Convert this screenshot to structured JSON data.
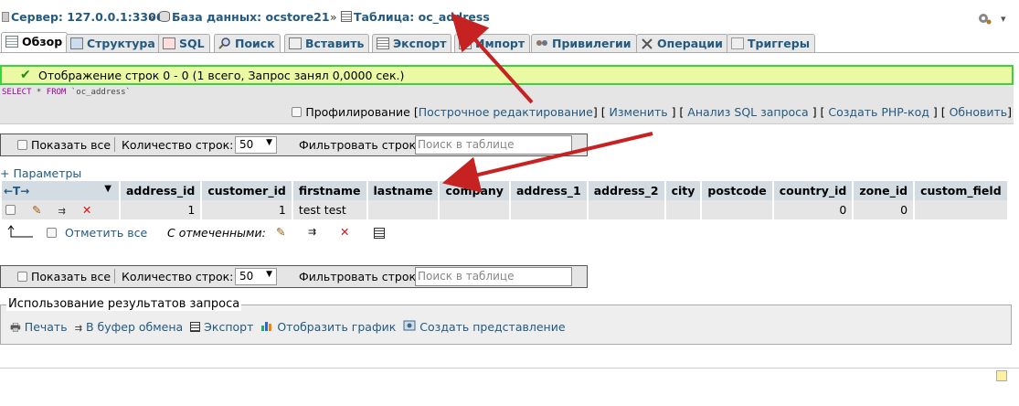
{
  "breadcrumb": {
    "server": "Сервер: 127.0.0.1:3306",
    "database": "База данных: ocstore21",
    "table": "Таблица: oc_address",
    "separator": "»"
  },
  "tabs": [
    {
      "label": "Обзор",
      "icon": "browse-icon",
      "active": true
    },
    {
      "label": "Структура",
      "icon": "structure-icon"
    },
    {
      "label": "SQL",
      "icon": "sql-icon"
    },
    {
      "label": "Поиск",
      "icon": "search-icon"
    },
    {
      "label": "Вставить",
      "icon": "insert-icon"
    },
    {
      "label": "Экспорт",
      "icon": "export-icon"
    },
    {
      "label": "Импорт",
      "icon": "import-icon"
    },
    {
      "label": "Привилегии",
      "icon": "privileges-icon"
    },
    {
      "label": "Операции",
      "icon": "operations-icon"
    },
    {
      "label": "Триггеры",
      "icon": "triggers-icon"
    }
  ],
  "success": {
    "message": "Отображение строк 0 - 0 (1 всего, Запрос занял 0,0000 сек.)"
  },
  "sql": {
    "select": "SELECT",
    "star": " * ",
    "from": "FROM",
    "table": " `oc_address`"
  },
  "sql_links": {
    "profiling": "Профилирование",
    "inline_edit": "Построчное редактирование",
    "edit": "Изменить",
    "explain": "Анализ SQL запроса",
    "php": "Создать PHP-код",
    "refresh": "Обновить"
  },
  "nav": {
    "show_all": "Показать все",
    "rows_label": "Количество строк:",
    "rows_value": "50",
    "filter_label": "Фильтровать строки:",
    "filter_placeholder": "Поиск в таблице"
  },
  "params_label": "+ Параметры",
  "table": {
    "columns": [
      "address_id",
      "customer_id",
      "firstname",
      "lastname",
      "company",
      "address_1",
      "address_2",
      "city",
      "postcode",
      "country_id",
      "zone_id",
      "custom_field"
    ],
    "rows": [
      {
        "address_id": "1",
        "customer_id": "1",
        "firstname": "test test",
        "lastname": "",
        "company": "",
        "address_1": "",
        "address_2": "",
        "city": "",
        "postcode": "",
        "country_id": "0",
        "zone_id": "0",
        "custom_field": ""
      }
    ]
  },
  "check_all": {
    "label": "Отметить все",
    "with_selected": "С отмеченными:"
  },
  "query_ops": {
    "legend": "Использование результатов запроса",
    "print": "Печать",
    "clipboard": "В буфер обмена",
    "export": "Экспорт",
    "chart": "Отобразить график",
    "view": "Создать представление"
  },
  "colors": {
    "link": "#235a81",
    "success_border": "#3bd23b",
    "success_bg": "#ebf8a4",
    "arrow": "#c62222",
    "header_bg": "#d3dce3"
  }
}
